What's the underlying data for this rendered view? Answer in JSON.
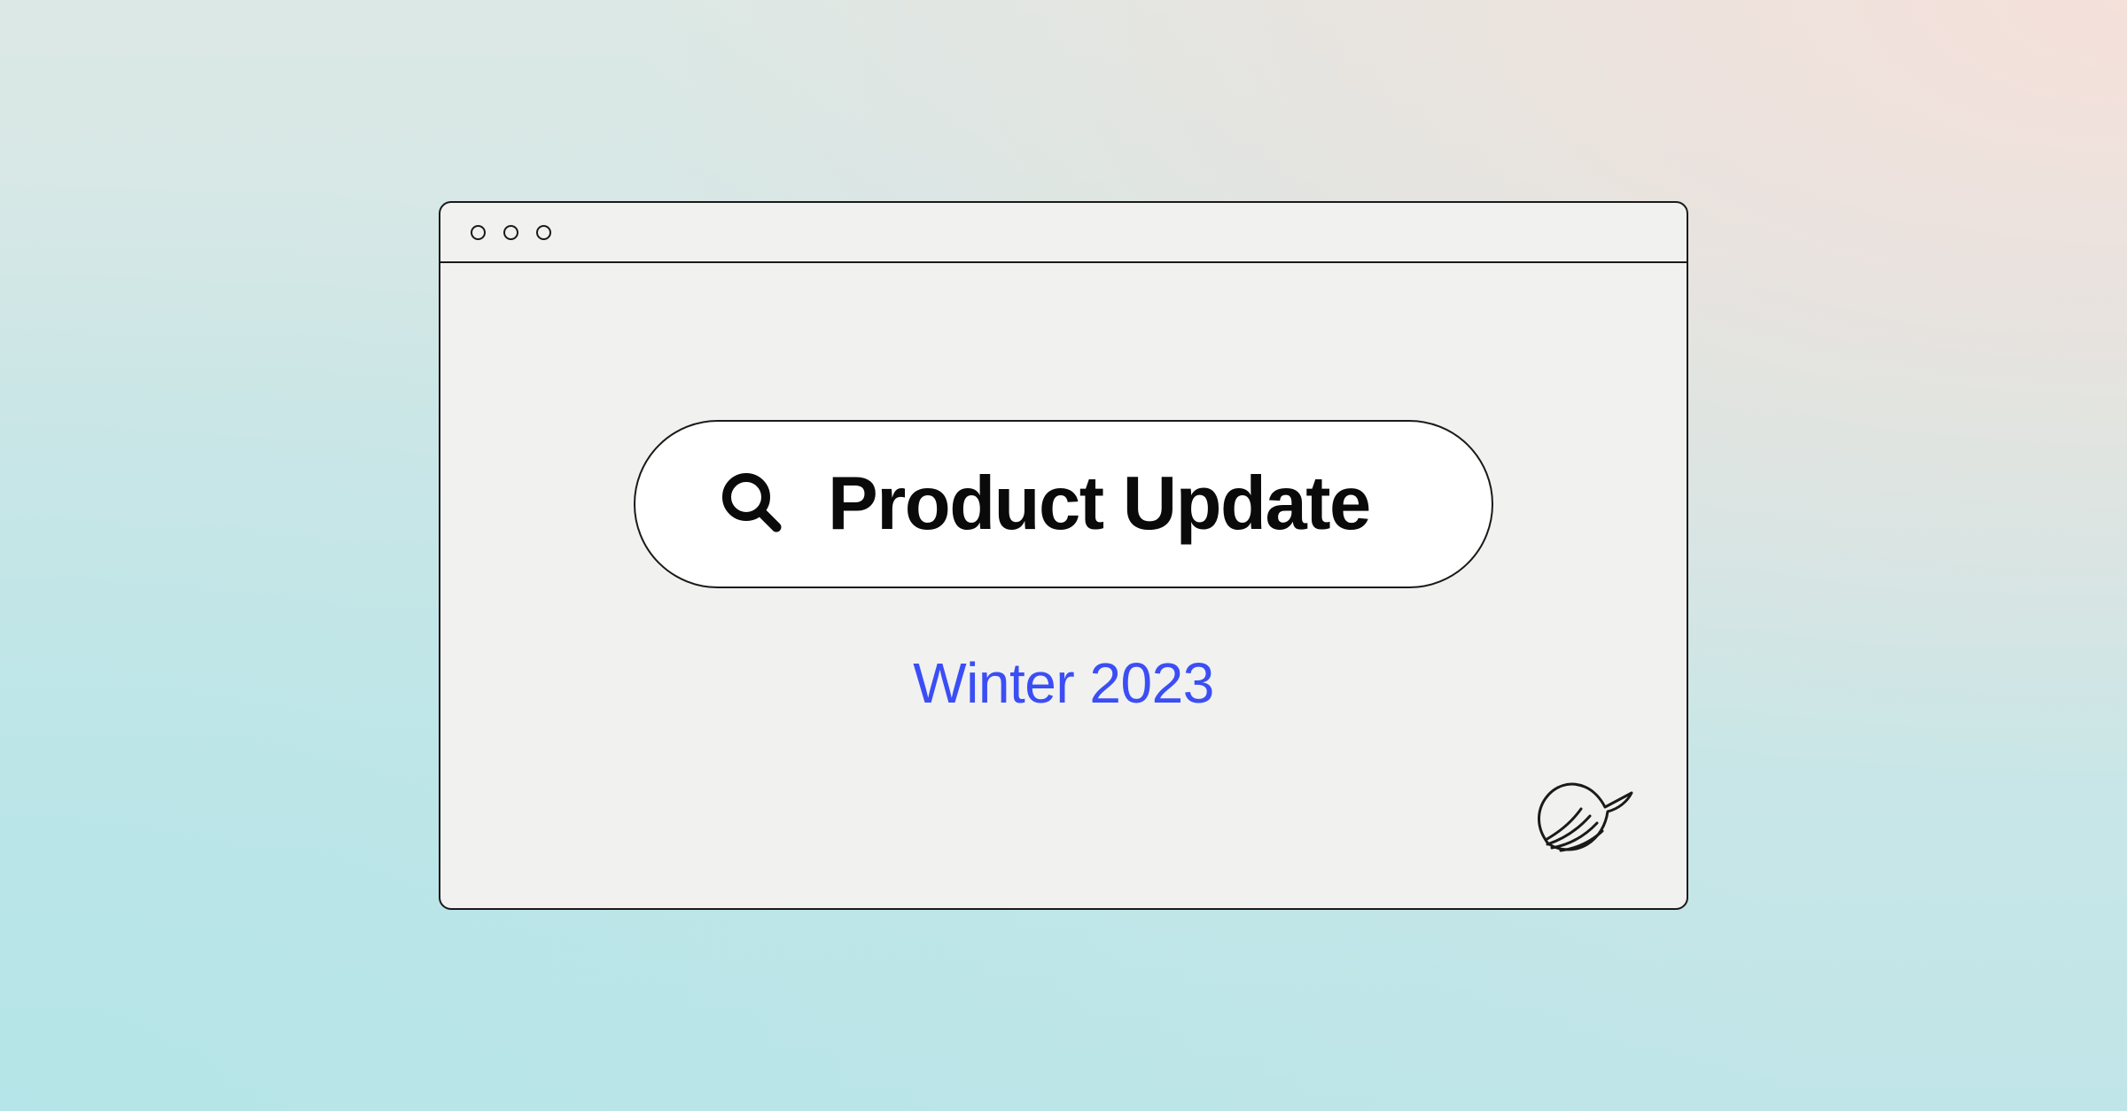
{
  "search": {
    "title": "Product Update"
  },
  "subtitle": "Winter 2023",
  "icons": {
    "search": "search-icon",
    "brand": "hummingbird-logo"
  }
}
